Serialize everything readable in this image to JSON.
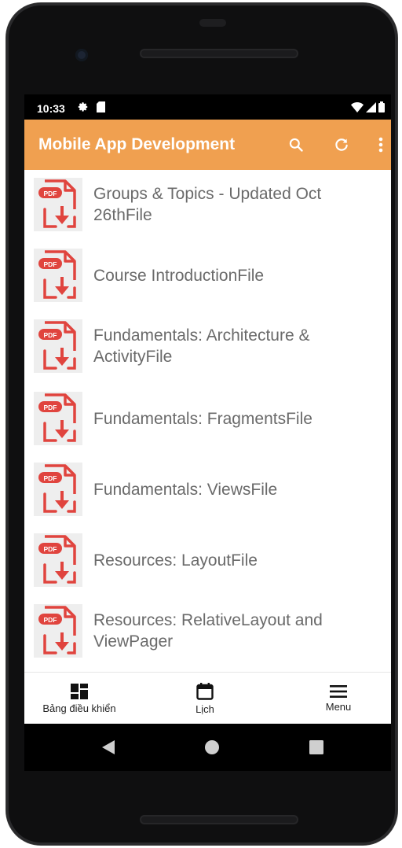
{
  "status_bar": {
    "time": "10:33"
  },
  "app_bar": {
    "title": "Mobile App Development"
  },
  "list": {
    "items": [
      {
        "title": "Groups & Topics - Updated Oct 26thFile",
        "badge": "PDF"
      },
      {
        "title": "Course IntroductionFile",
        "badge": "PDF"
      },
      {
        "title": "Fundamentals: Architecture & ActivityFile",
        "badge": "PDF"
      },
      {
        "title": "Fundamentals: FragmentsFile",
        "badge": "PDF"
      },
      {
        "title": "Fundamentals: ViewsFile",
        "badge": "PDF"
      },
      {
        "title": "Resources: LayoutFile",
        "badge": "PDF"
      },
      {
        "title": "Resources: RelativeLayout and ViewPager",
        "badge": "PDF"
      }
    ]
  },
  "bottom_nav": {
    "items": [
      {
        "label": "Bảng điều khiển",
        "icon": "dashboard-icon"
      },
      {
        "label": "Lịch",
        "icon": "calendar-icon"
      },
      {
        "label": "Menu",
        "icon": "menu-icon"
      }
    ]
  },
  "colors": {
    "app_bar": "#F0A050",
    "pdf_red": "#E0443E",
    "title_gray": "#6A6A6A"
  }
}
